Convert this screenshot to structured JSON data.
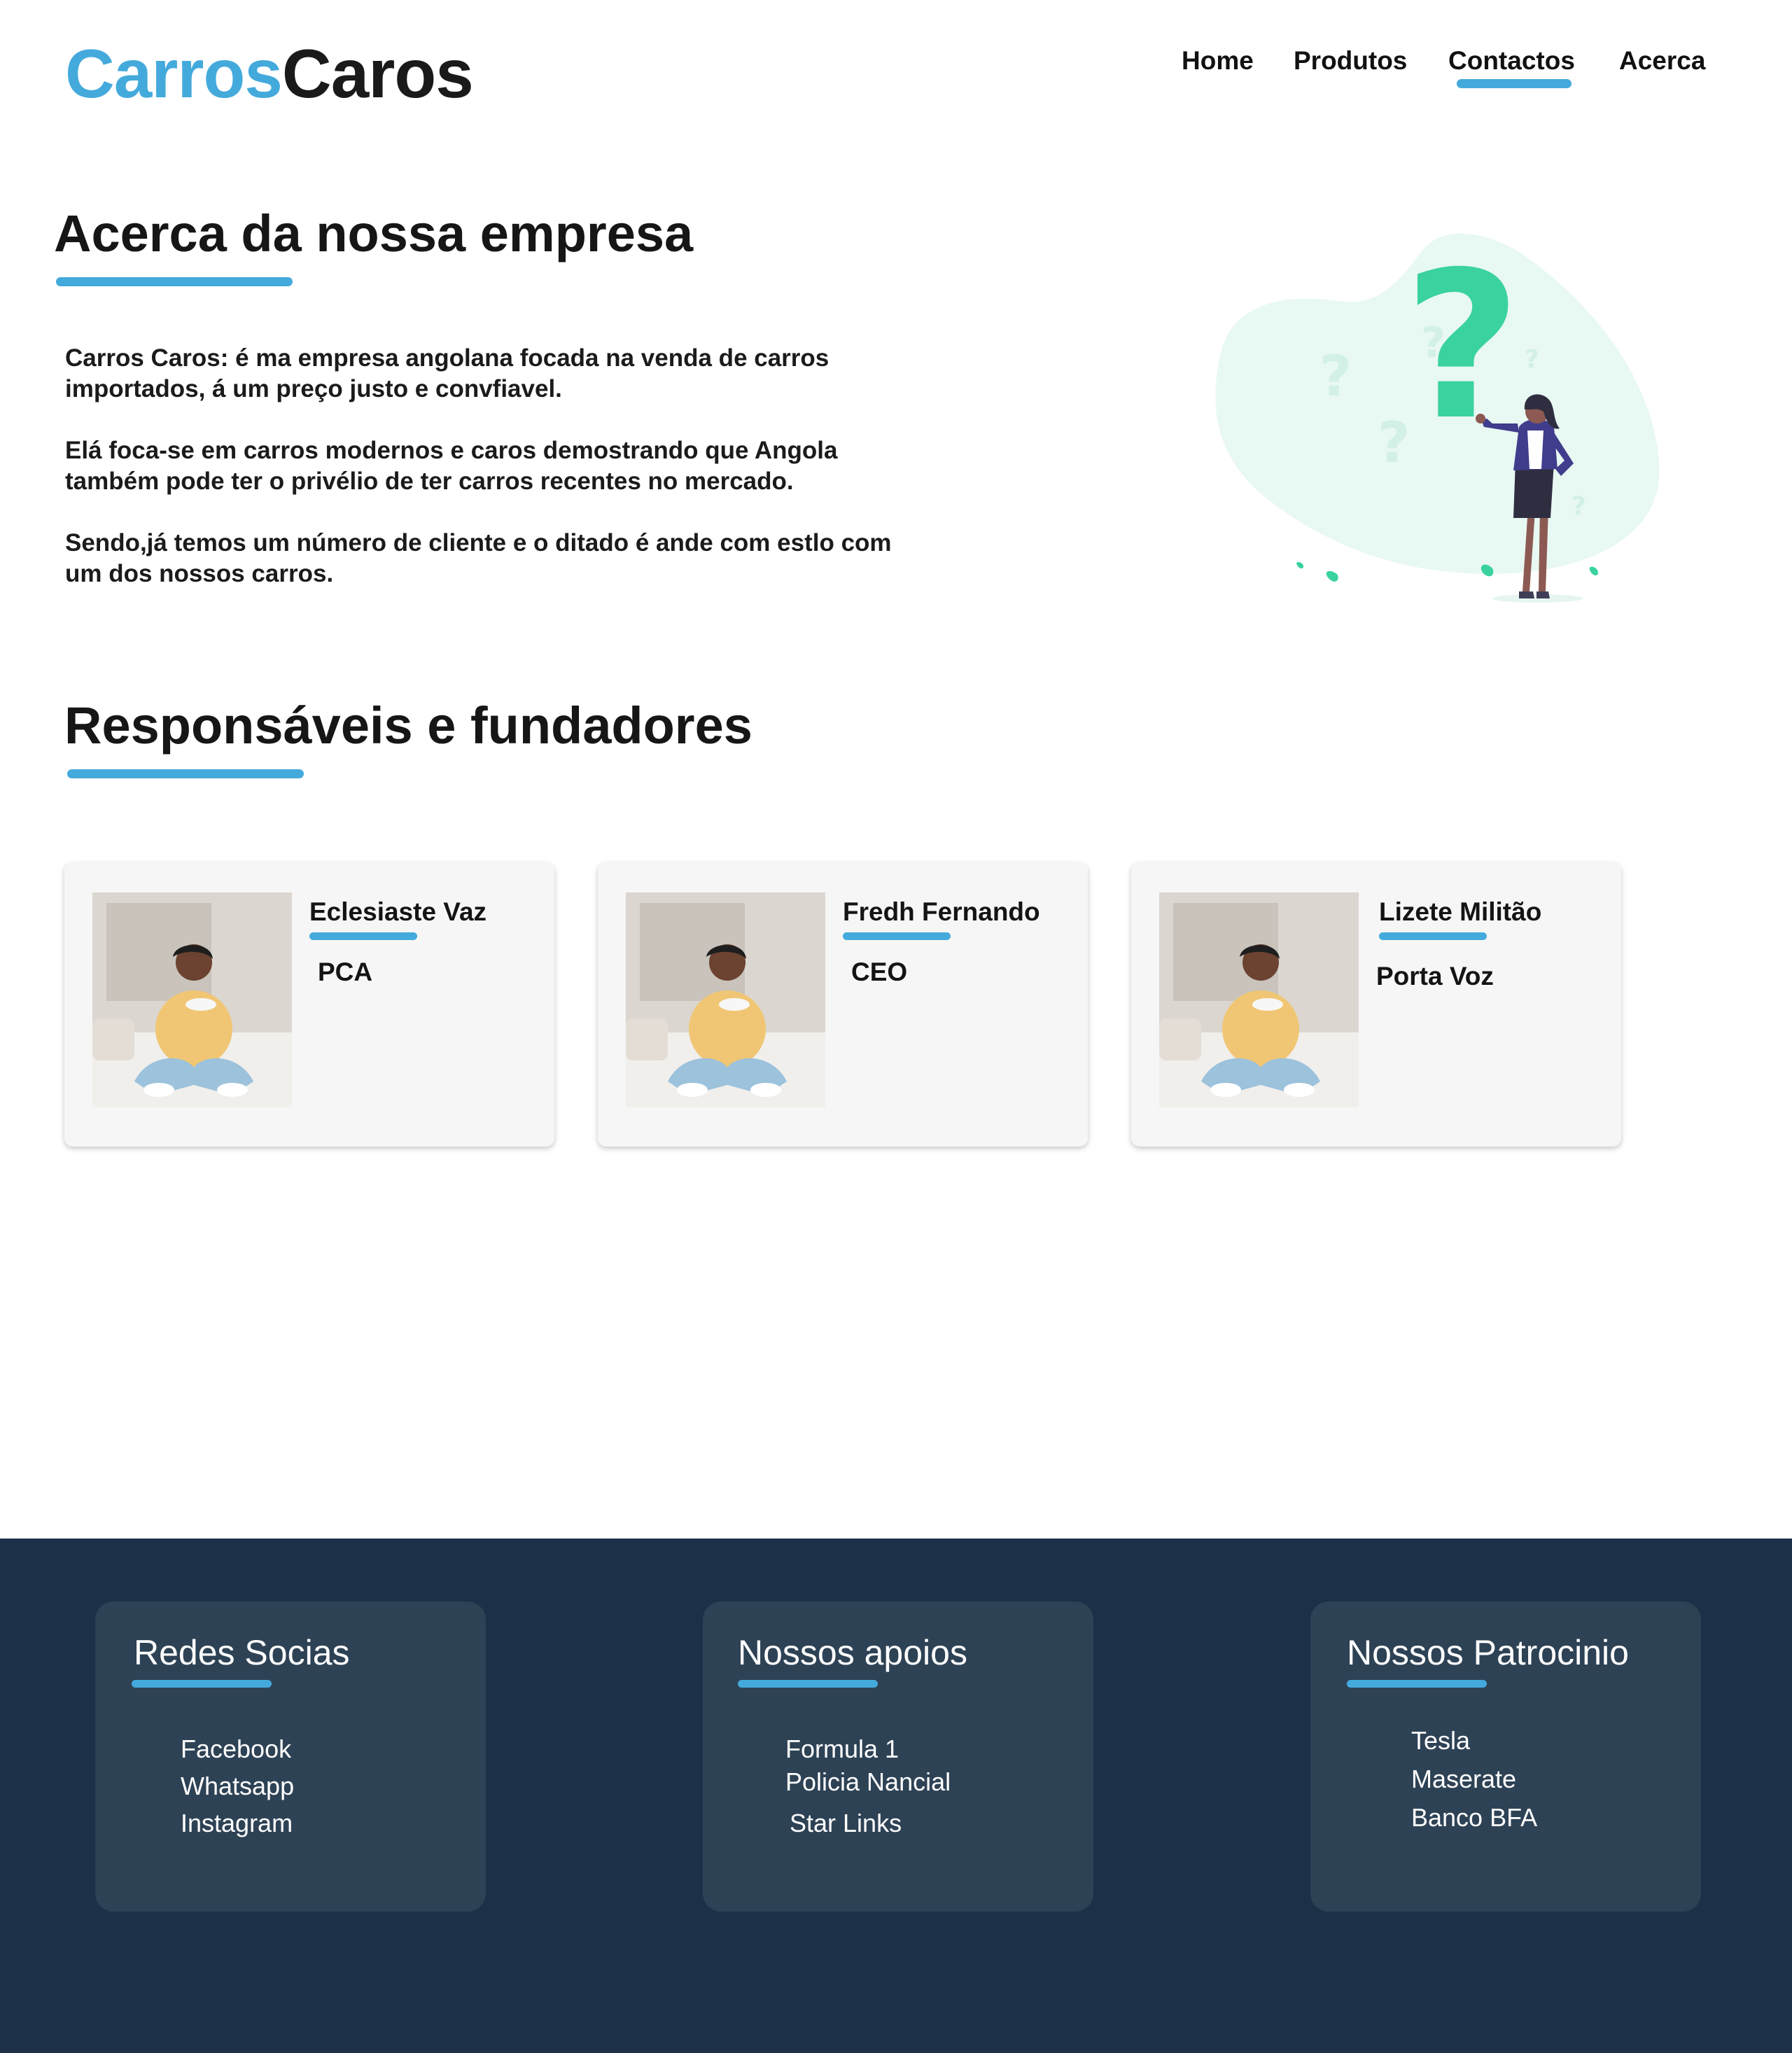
{
  "header": {
    "logo_part1": "Carros",
    "logo_part2": "Caros",
    "nav": [
      "Home",
      "Produtos",
      "Contactos",
      "Acerca"
    ],
    "active_nav": "Contactos"
  },
  "about": {
    "title": "Acerca da nossa empresa",
    "paragraphs": [
      "Carros Caros: é ma empresa angolana focada na venda de carros importados, á um preço justo e convfiavel.",
      "Elá foca-se em carros modernos e caros demostrando que Angola também pode ter o privélio de ter carros recentes no mercado.",
      "Sendo,já temos um número de cliente  e o ditado é ande com estlo com um dos nossos carros."
    ]
  },
  "team": {
    "title": "Responsáveis e fundadores",
    "members": [
      {
        "name": "Eclesiaste Vaz",
        "role": "PCA"
      },
      {
        "name": "Fredh Fernando",
        "role": "CEO"
      },
      {
        "name": "Lizete Militão",
        "role": "Porta Voz"
      }
    ]
  },
  "footer": {
    "boxes": [
      {
        "title": "Redes Socias",
        "items": [
          "Facebook",
          "Whatsapp",
          "Instagram"
        ]
      },
      {
        "title": "Nossos apoios",
        "items": [
          "Formula 1",
          "Policia Nancial",
          "Star Links"
        ]
      },
      {
        "title": "Nossos Patrocinio",
        "items": [
          "Tesla",
          "Maserate",
          "Banco BFA"
        ]
      }
    ]
  },
  "colors": {
    "accent": "#44aadc",
    "footer_bg": "#1c3047",
    "footer_box": "#2e4255",
    "illustration_green": "#3ad29f"
  }
}
